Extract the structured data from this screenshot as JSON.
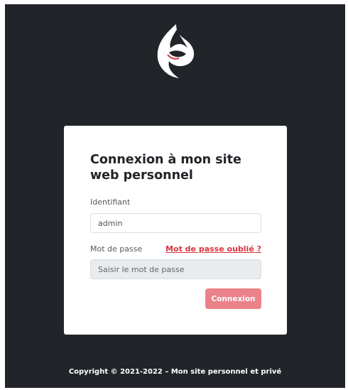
{
  "logo": {
    "icon": "ghost-flame-logo-icon",
    "accent": "#d8343f"
  },
  "login": {
    "title": "Connexion à mon site web personnel",
    "username_label": "Identifiant",
    "username_value": "admin",
    "password_label": "Mot de passe",
    "forgot_link": "Mot de passe oublié ?",
    "password_placeholder": "Saisir le mot de passe",
    "password_value": "",
    "submit_label": "Connexion"
  },
  "footer": {
    "copyright": "Copyright © 2021-2022 – Mon site personnel et privé"
  },
  "colors": {
    "background": "#212429",
    "card": "#ffffff",
    "link": "#d8343f",
    "button": "#eb8189"
  }
}
